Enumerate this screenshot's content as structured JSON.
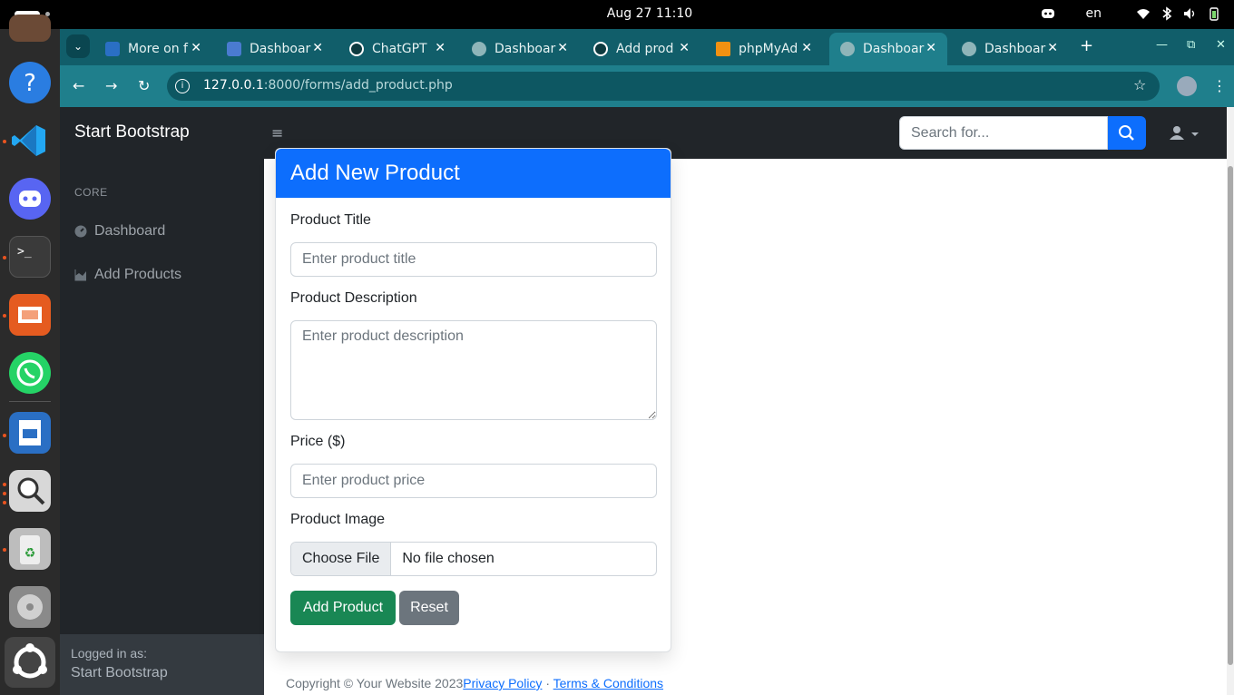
{
  "system": {
    "clock": "Aug 27  11:10",
    "lang": "en"
  },
  "browser": {
    "tabs": [
      {
        "title": "More on f"
      },
      {
        "title": "Dashboar"
      },
      {
        "title": "ChatGPT"
      },
      {
        "title": "Dashboar"
      },
      {
        "title": "Add prod"
      },
      {
        "title": "phpMyAd"
      },
      {
        "title": "Dashboar"
      },
      {
        "title": "Dashboar"
      }
    ],
    "active_tab": 6,
    "url_host": "127.0.0.1",
    "url_rest": ":8000/forms/add_product.php"
  },
  "app": {
    "brand": "Start Bootstrap",
    "search_placeholder": "Search for...",
    "sidebar": {
      "heading": "CORE",
      "items": [
        {
          "label": "Dashboard"
        },
        {
          "label": "Add Products"
        }
      ],
      "footer_label": "Logged in as:",
      "footer_user": "Start Bootstrap"
    },
    "form": {
      "title": "Add New Product",
      "title_label": "Product Title",
      "title_placeholder": "Enter product title",
      "desc_label": "Product Description",
      "desc_placeholder": "Enter product description",
      "price_label": "Price ($)",
      "price_placeholder": "Enter product price",
      "image_label": "Product Image",
      "file_button": "Choose File",
      "file_status": "No file chosen",
      "submit": "Add Product",
      "reset": "Reset"
    },
    "footer": {
      "copyright": "Copyright © Your Website 2023",
      "privacy": "Privacy Policy",
      "sep": " · ",
      "terms": "Terms & Conditions"
    }
  },
  "colors": {
    "primary": "#0d6efd",
    "success": "#198754",
    "secondary": "#6c757d",
    "dark": "#212529",
    "browser_teal": "#1f7f8c"
  }
}
